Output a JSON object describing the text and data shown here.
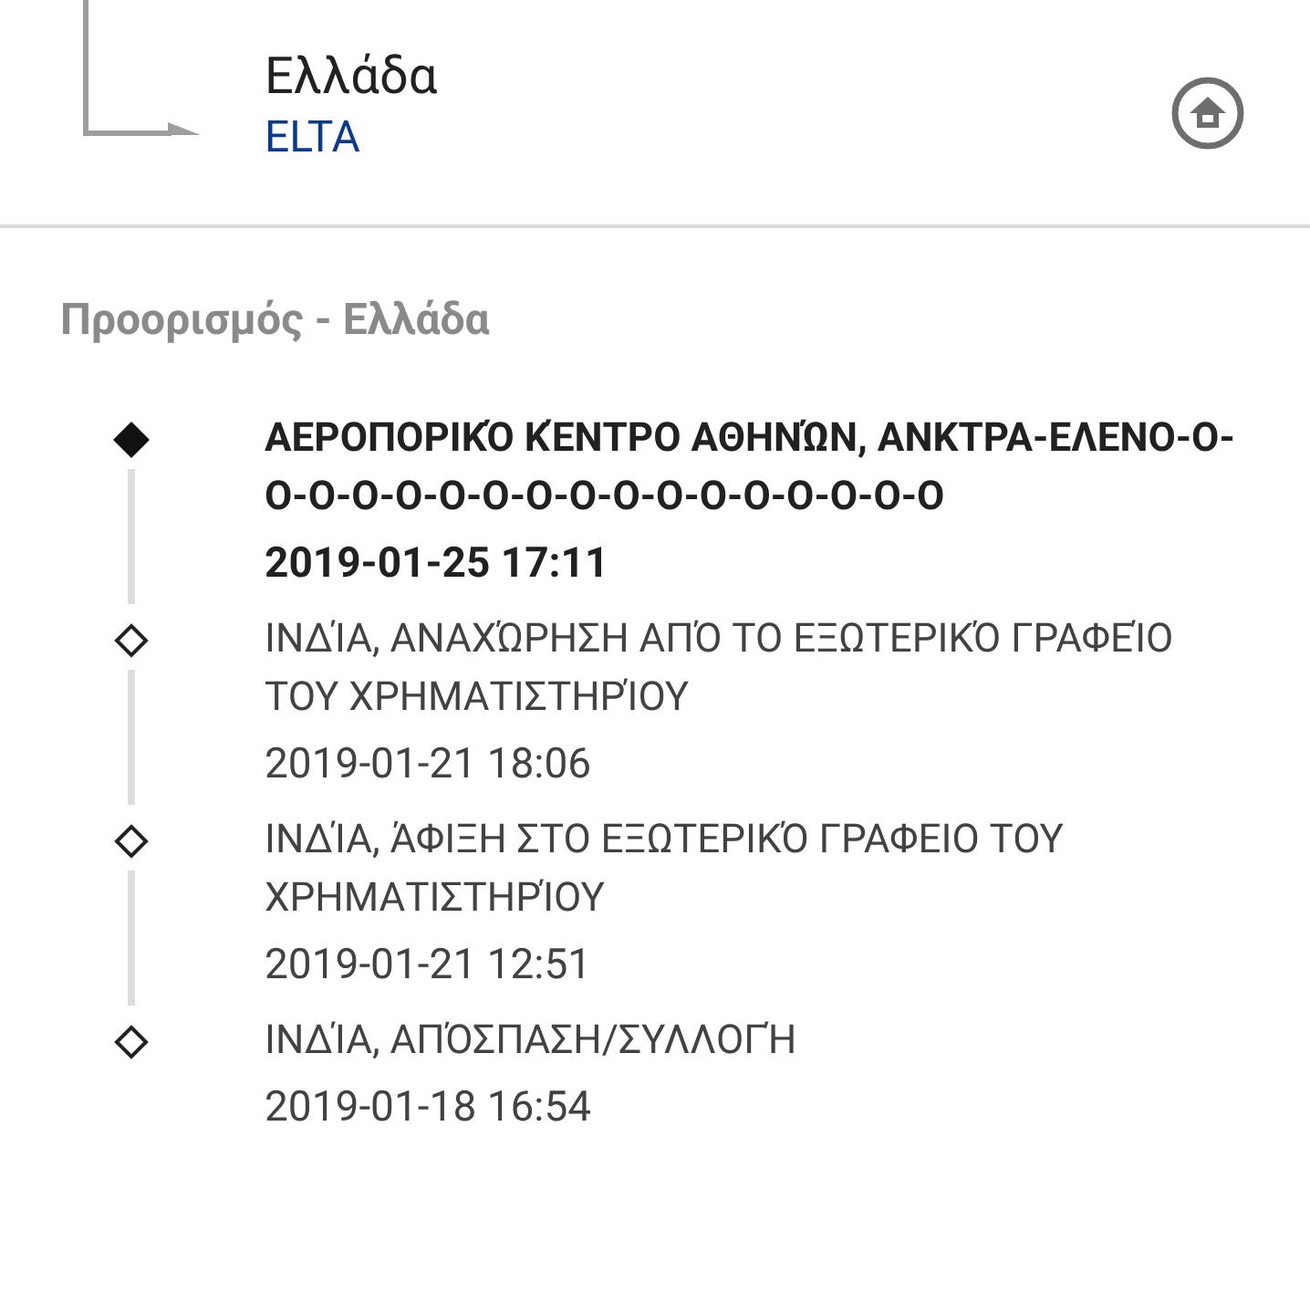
{
  "route": {
    "country": "Ελλάδα",
    "carrier": "ELTA"
  },
  "section_heading": "Προορισμός - Ελλάδα",
  "events": [
    {
      "description": "ΑΕΡΟΠΟΡΙΚΌ ΚΈΝΤΡΟ ΑΘΗΝΏΝ, ΑΝΚΤΡΑ-ΕΛΕΝΟ-Ο-Ο-Ο-Ο-Ο-Ο-Ο-Ο-Ο-Ο-Ο-Ο-Ο-Ο-Ο-Ο-Ο",
      "time": "2019-01-25 17:11",
      "current": true
    },
    {
      "description": "ΙΝΔΊΑ, ΑΝΑΧΏΡΗΣΗ ΑΠΌ ΤΟ ΕΞΩΤΕΡΙΚΌ ΓΡΑΦΕΊΟ ΤΟΥ ΧΡΗΜΑΤΙΣΤΗΡΊΟΥ",
      "time": "2019-01-21 18:06",
      "current": false
    },
    {
      "description": "ΙΝΔΊΑ, ΆΦΙΞΗ ΣΤΟ ΕΞΩΤΕΡΙΚΌ ΓΡΑΦΕΙΟ ΤΟΥ ΧΡΗΜΑΤΙΣΤΗΡΊΟΥ",
      "time": "2019-01-21 12:51",
      "current": false
    },
    {
      "description": "ΙΝΔΊΑ, ΑΠΌΣΠΑΣΗ/ΣΥΛΛΟΓΉ",
      "time": "2019-01-18 16:54",
      "current": false
    }
  ]
}
